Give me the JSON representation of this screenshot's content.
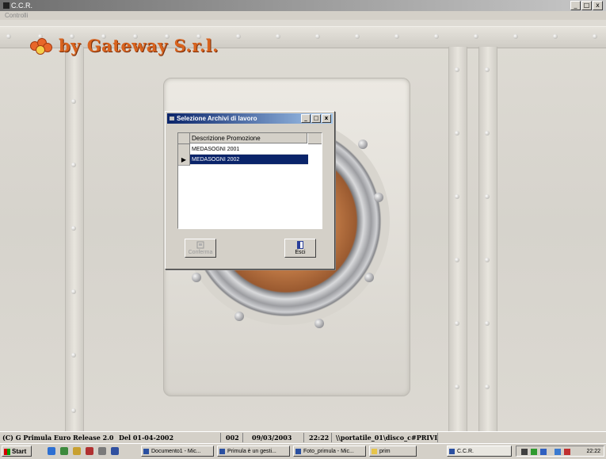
{
  "window": {
    "title": "C.C.R.",
    "menu_item": "Controlli",
    "btn_min": "_",
    "btn_max": "□",
    "btn_close": "x"
  },
  "logo": {
    "text": "by Gateway S.r.l."
  },
  "dialog": {
    "title": "Selezione Archivi di lavoro",
    "column_header": "Descrizione Promozione",
    "rows": [
      {
        "label": "MEDASOGNI 2001",
        "selected": false
      },
      {
        "label": "MEDASOGNI 2002",
        "selected": true
      }
    ],
    "row_pointer": "▶",
    "btn_confirm": "Conferma",
    "btn_exit": "Esci"
  },
  "status": {
    "version": "(C) G  Primula  Euro Release 2.0",
    "date_label": "Del  01-04-2002",
    "code": "002",
    "date": "09/03/2003",
    "time": "22:22",
    "path": "\\\\portatile_01\\disco_c#PRIVI"
  },
  "taskbar": {
    "start": "Start",
    "tasks": [
      "Documento1 - Mic...",
      "Primula è un gesti...",
      "Foto_primula - Mic...",
      "prim"
    ],
    "active": "C.C.R.",
    "clock": "22:22"
  },
  "colors": {
    "logo": "#d8631e",
    "selection": "#0a246a",
    "titlebar_active": "#0a246a"
  }
}
